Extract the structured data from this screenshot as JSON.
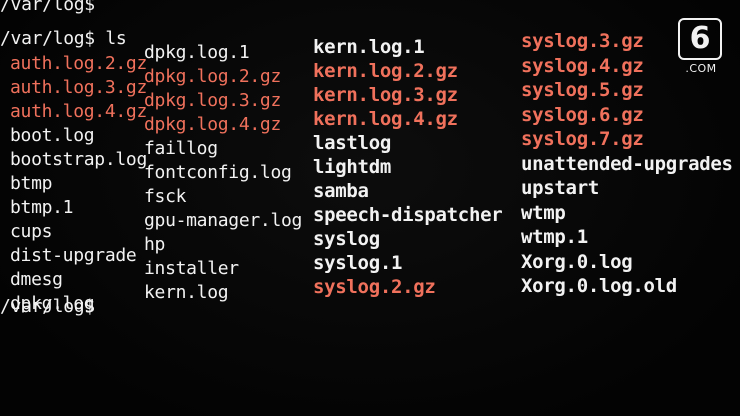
{
  "terminal": {
    "prompt_top": "/var/log$",
    "command_line": "/var/log$ ls",
    "prompt_bottom": "/var/log$",
    "columns": [
      [
        {
          "name": "auth.log.2.gz",
          "gz": true
        },
        {
          "name": "auth.log.3.gz",
          "gz": true
        },
        {
          "name": "auth.log.4.gz",
          "gz": true
        },
        {
          "name": "boot.log",
          "gz": false
        },
        {
          "name": "bootstrap.log",
          "gz": false
        },
        {
          "name": "btmp",
          "gz": false
        },
        {
          "name": "btmp.1",
          "gz": false
        },
        {
          "name": "cups",
          "gz": false
        },
        {
          "name": "dist-upgrade",
          "gz": false
        },
        {
          "name": "dmesg",
          "gz": false
        },
        {
          "name": "dpkg.log",
          "gz": false
        }
      ],
      [
        {
          "name": "dpkg.log.1",
          "gz": false
        },
        {
          "name": "dpkg.log.2.gz",
          "gz": true
        },
        {
          "name": "dpkg.log.3.gz",
          "gz": true
        },
        {
          "name": "dpkg.log.4.gz",
          "gz": true
        },
        {
          "name": "faillog",
          "gz": false
        },
        {
          "name": "fontconfig.log",
          "gz": false
        },
        {
          "name": "fsck",
          "gz": false
        },
        {
          "name": "gpu-manager.log",
          "gz": false
        },
        {
          "name": "hp",
          "gz": false
        },
        {
          "name": "installer",
          "gz": false
        },
        {
          "name": "kern.log",
          "gz": false
        }
      ],
      [
        {
          "name": "kern.log.1",
          "gz": false
        },
        {
          "name": "kern.log.2.gz",
          "gz": true
        },
        {
          "name": "kern.log.3.gz",
          "gz": true
        },
        {
          "name": "kern.log.4.gz",
          "gz": true
        },
        {
          "name": "lastlog",
          "gz": false
        },
        {
          "name": "lightdm",
          "gz": false
        },
        {
          "name": "samba",
          "gz": false
        },
        {
          "name": "speech-dispatcher",
          "gz": false
        },
        {
          "name": "syslog",
          "gz": false
        },
        {
          "name": "syslog.1",
          "gz": false
        },
        {
          "name": "syslog.2.gz",
          "gz": true
        }
      ],
      [
        {
          "name": "syslog.3.gz",
          "gz": true
        },
        {
          "name": "syslog.4.gz",
          "gz": true
        },
        {
          "name": "syslog.5.gz",
          "gz": true
        },
        {
          "name": "syslog.6.gz",
          "gz": true
        },
        {
          "name": "syslog.7.gz",
          "gz": true
        },
        {
          "name": "unattended-upgrades",
          "gz": false
        },
        {
          "name": "upstart",
          "gz": false
        },
        {
          "name": "wtmp",
          "gz": false
        },
        {
          "name": "wtmp.1",
          "gz": false
        },
        {
          "name": "Xorg.0.log",
          "gz": false
        },
        {
          "name": "Xorg.0.log.old",
          "gz": false
        }
      ]
    ]
  },
  "watermark": {
    "glyph": "6",
    "sub": ".COM"
  },
  "colors": {
    "background": "#050505",
    "text": "#f2f2f2",
    "gz_archive": "#f0715c"
  }
}
